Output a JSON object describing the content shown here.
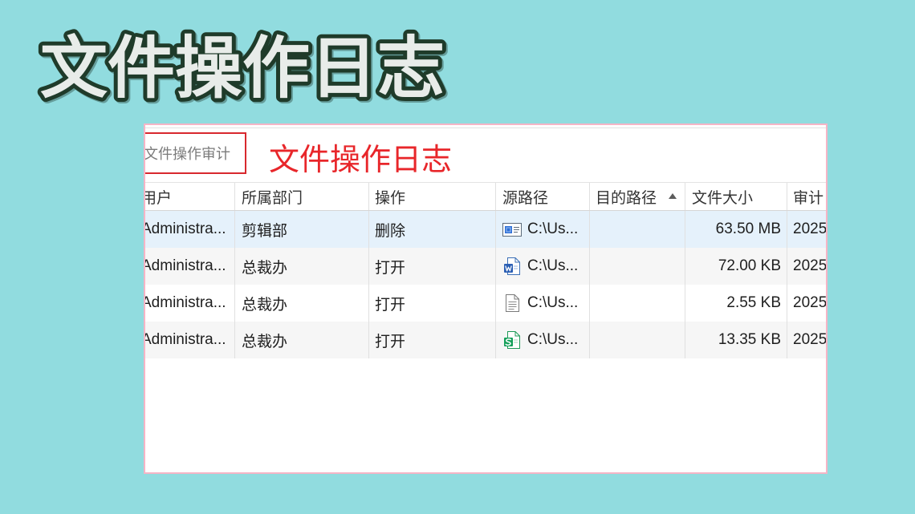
{
  "colors": {
    "background": "#91dcdf",
    "title_fill": "#e8ece9",
    "title_stroke": "#1f3b2a",
    "frame_border": "#f5b5c6",
    "highlight_box": "#d8282e",
    "section_title": "#e8262a",
    "selected_row": "#e5f1fb"
  },
  "title": "文件操作日志",
  "tab": {
    "label": "文件操作审计"
  },
  "section_title": "文件操作日志",
  "table": {
    "columns": [
      {
        "label": "用户"
      },
      {
        "label": "所属部门"
      },
      {
        "label": "操作"
      },
      {
        "label": "源路径"
      },
      {
        "label": "目的路径",
        "sort_icon": "sort-ascending-icon"
      },
      {
        "label": "文件大小"
      },
      {
        "label": "审计"
      }
    ],
    "rows": [
      {
        "user": "Administra...",
        "department": "剪辑部",
        "operation": "删除",
        "file_icon": "media-file-icon",
        "source_path": "C:\\Us...",
        "target_path": "",
        "file_size": "63.50 MB",
        "audit_time": "2025",
        "selected": true
      },
      {
        "user": "Administra...",
        "department": "总裁办",
        "operation": "打开",
        "file_icon": "word-file-icon",
        "source_path": "C:\\Us...",
        "target_path": "",
        "file_size": "72.00 KB",
        "audit_time": "2025",
        "selected": false
      },
      {
        "user": "Administra...",
        "department": "总裁办",
        "operation": "打开",
        "file_icon": "text-file-icon",
        "source_path": "C:\\Us...",
        "target_path": "",
        "file_size": "2.55 KB",
        "audit_time": "2025",
        "selected": false
      },
      {
        "user": "Administra...",
        "department": "总裁办",
        "operation": "打开",
        "file_icon": "spreadsheet-file-icon",
        "source_path": "C:\\Us...",
        "target_path": "",
        "file_size": "13.35 KB",
        "audit_time": "2025",
        "selected": false
      }
    ]
  }
}
